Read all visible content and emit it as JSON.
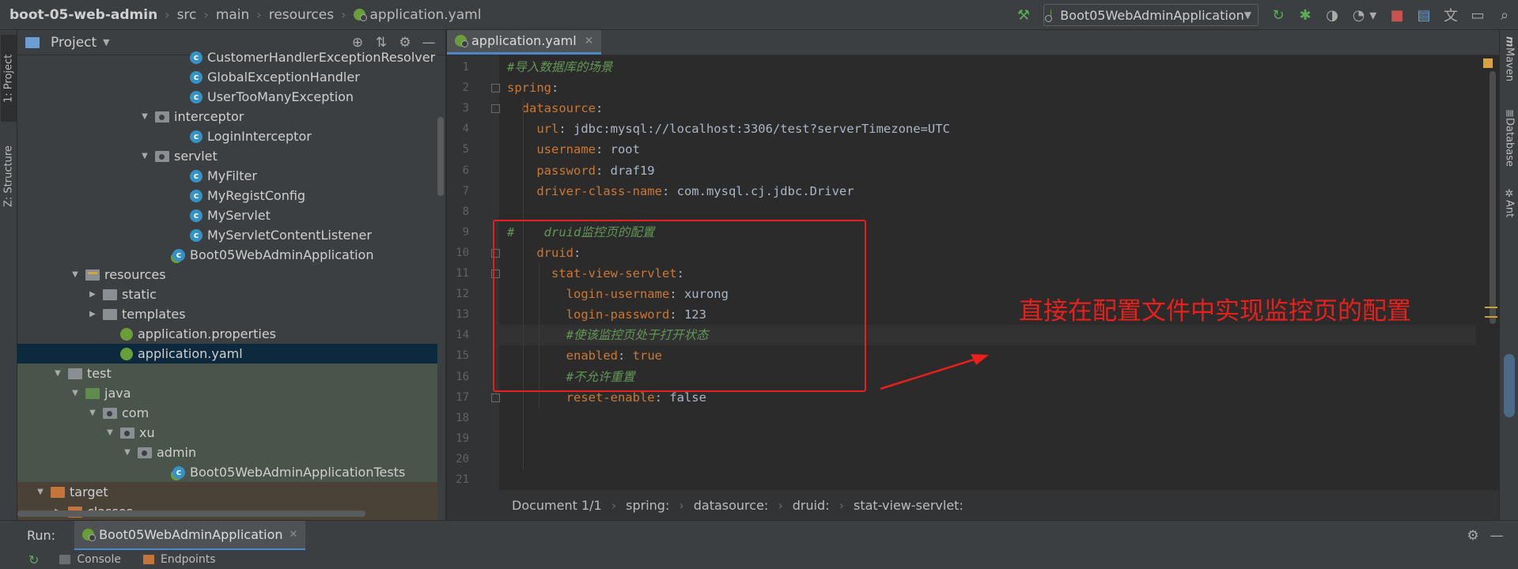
{
  "navbar": {
    "breadcrumbs": [
      "boot-05-web-admin",
      "src",
      "main",
      "resources",
      "application.yaml"
    ],
    "run_config": "Boot05WebAdminApplication"
  },
  "left_strip": {
    "project_tab": "1: Project",
    "structure_tab": "Z: Structure"
  },
  "right_strip": {
    "maven": "Maven",
    "database": "Database",
    "ant": "Ant"
  },
  "project": {
    "title": "Project",
    "tree": [
      {
        "label": "CustomerHandlerExceptionResolver",
        "type": "class",
        "indent": 9,
        "twisty": ""
      },
      {
        "label": "GlobalExceptionHandler",
        "type": "class",
        "indent": 9,
        "twisty": ""
      },
      {
        "label": "UserTooManyException",
        "type": "class",
        "indent": 9,
        "twisty": ""
      },
      {
        "label": "interceptor",
        "type": "package",
        "indent": 7,
        "twisty": "▼"
      },
      {
        "label": "LoginInterceptor",
        "type": "class",
        "indent": 9,
        "twisty": ""
      },
      {
        "label": "servlet",
        "type": "package",
        "indent": 7,
        "twisty": "▼"
      },
      {
        "label": "MyFilter",
        "type": "class",
        "indent": 9,
        "twisty": ""
      },
      {
        "label": "MyRegistConfig",
        "type": "class",
        "indent": 9,
        "twisty": ""
      },
      {
        "label": "MyServlet",
        "type": "class",
        "indent": 9,
        "twisty": ""
      },
      {
        "label": "MyServletContentListener",
        "type": "class",
        "indent": 9,
        "twisty": ""
      },
      {
        "label": "Boot05WebAdminApplication",
        "type": "springclass",
        "indent": 8,
        "twisty": ""
      },
      {
        "label": "resources",
        "type": "resfolder",
        "indent": 3,
        "twisty": "▼"
      },
      {
        "label": "static",
        "type": "folder",
        "indent": 4,
        "twisty": "▶"
      },
      {
        "label": "templates",
        "type": "folder",
        "indent": 4,
        "twisty": "▶"
      },
      {
        "label": "application.properties",
        "type": "spring",
        "indent": 5,
        "twisty": ""
      },
      {
        "label": "application.yaml",
        "type": "spring",
        "indent": 5,
        "twisty": "",
        "selected": true
      },
      {
        "label": "test",
        "type": "folder",
        "indent": 2,
        "twisty": "▼",
        "zone": "test"
      },
      {
        "label": "java",
        "type": "greenfolder",
        "indent": 3,
        "twisty": "▼",
        "zone": "test"
      },
      {
        "label": "com",
        "type": "package",
        "indent": 4,
        "twisty": "▼",
        "zone": "test"
      },
      {
        "label": "xu",
        "type": "package",
        "indent": 5,
        "twisty": "▼",
        "zone": "test"
      },
      {
        "label": "admin",
        "type": "package",
        "indent": 6,
        "twisty": "▼",
        "zone": "test"
      },
      {
        "label": "Boot05WebAdminApplicationTests",
        "type": "springclass",
        "indent": 8,
        "twisty": "",
        "zone": "test"
      },
      {
        "label": "target",
        "type": "orangefolder",
        "indent": 1,
        "twisty": "▼",
        "zone": "target"
      },
      {
        "label": "classes",
        "type": "orangefolder",
        "indent": 2,
        "twisty": "▶",
        "zone": "target"
      }
    ]
  },
  "editor": {
    "tab_label": "application.yaml",
    "lines": [
      [
        {
          "t": "#导入数据库的场景",
          "c": "c"
        }
      ],
      [
        {
          "t": "spring",
          "c": "k"
        },
        {
          "t": ":",
          "c": "p"
        }
      ],
      [
        {
          "t": "  datasource",
          "c": "k"
        },
        {
          "t": ":",
          "c": "p"
        }
      ],
      [
        {
          "t": "    url",
          "c": "k"
        },
        {
          "t": ": jdbc:mysql://localhost:3306/test?serverTimezone=UTC",
          "c": "v"
        }
      ],
      [
        {
          "t": "    username",
          "c": "k"
        },
        {
          "t": ": root",
          "c": "v"
        }
      ],
      [
        {
          "t": "    password",
          "c": "k"
        },
        {
          "t": ": draf19",
          "c": "v"
        }
      ],
      [
        {
          "t": "    driver-class-name",
          "c": "k"
        },
        {
          "t": ": com.mysql.cj.jdbc.Driver",
          "c": "v"
        }
      ],
      [
        {
          "t": "",
          "c": "v"
        }
      ],
      [
        {
          "t": "#    druid监控页的配置",
          "c": "c"
        }
      ],
      [
        {
          "t": "    druid",
          "c": "k"
        },
        {
          "t": ":",
          "c": "p"
        }
      ],
      [
        {
          "t": "      stat-view-servlet",
          "c": "k"
        },
        {
          "t": ":",
          "c": "p"
        }
      ],
      [
        {
          "t": "        login-username",
          "c": "k"
        },
        {
          "t": ": xurong",
          "c": "v"
        }
      ],
      [
        {
          "t": "        login-password",
          "c": "k"
        },
        {
          "t": ": 123",
          "c": "v"
        }
      ],
      [
        {
          "t": "        #使该监控页处于打开状态",
          "c": "c"
        }
      ],
      [
        {
          "t": "        enabled",
          "c": "k"
        },
        {
          "t": ": ",
          "c": "p"
        },
        {
          "t": "true",
          "c": "k"
        }
      ],
      [
        {
          "t": "        #不允许重置",
          "c": "c"
        }
      ],
      [
        {
          "t": "        reset-enable",
          "c": "k"
        },
        {
          "t": ": ",
          "c": "p"
        },
        {
          "t": "false",
          "c": "v"
        }
      ],
      [
        {
          "t": "",
          "c": "v"
        }
      ],
      [
        {
          "t": "",
          "c": "v"
        }
      ],
      [
        {
          "t": "",
          "c": "v"
        }
      ],
      [
        {
          "t": "",
          "c": "v"
        }
      ]
    ],
    "current_line": 14,
    "annotation": "直接在配置文件中实现监控页的配置",
    "breadcrumb": [
      "Document 1/1",
      "spring:",
      "datasource:",
      "druid:",
      "stat-view-servlet:"
    ]
  },
  "run": {
    "label": "Run:",
    "tab": "Boot05WebAdminApplication",
    "console": "Console",
    "endpoints": "Endpoints"
  },
  "colors": {
    "accent": "#4a88c7",
    "annotation_red": "#e8201c",
    "selection": "#0d293e"
  }
}
